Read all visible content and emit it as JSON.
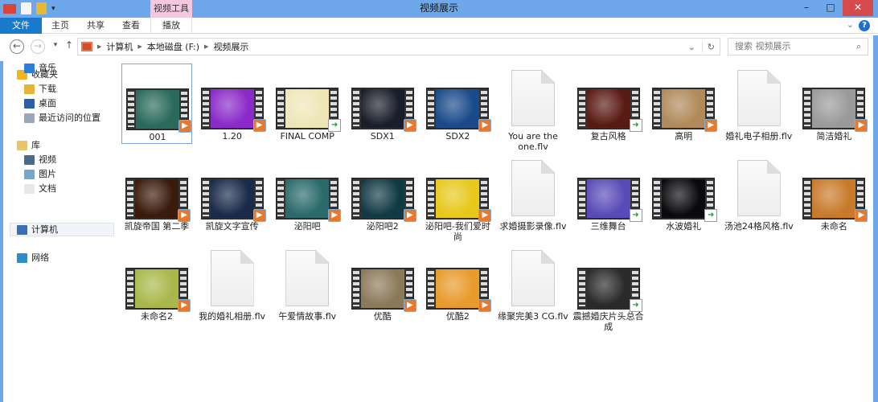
{
  "window": {
    "title": "视频展示",
    "context_tab": "视频工具",
    "minimize": "–",
    "maximize": "□",
    "close": "✕"
  },
  "ribbon": {
    "tabs": [
      "文件",
      "主页",
      "共享",
      "查看",
      "播放"
    ],
    "help": "?"
  },
  "nav": {
    "back": "←",
    "forward": "→",
    "recent": "▾",
    "up": "↑",
    "breadcrumb": [
      "计算机",
      "本地磁盘 (F:)",
      "视频展示"
    ],
    "refresh": "↻",
    "dropdown": "⌄",
    "search_placeholder": "搜索 视频展示",
    "search_icon": "⌕"
  },
  "sidebar": {
    "groups": [
      {
        "label": "收藏夹",
        "icon": "star-icon",
        "color": "#f2b51d",
        "children": [
          {
            "label": "下载",
            "icon": "downloads-icon",
            "color": "#e6b43a"
          },
          {
            "label": "桌面",
            "icon": "desktop-icon",
            "color": "#2a5fa8"
          },
          {
            "label": "最近访问的位置",
            "icon": "recent-places-icon",
            "color": "#9aa8b8"
          }
        ]
      },
      {
        "label": "库",
        "icon": "library-icon",
        "color": "#e9c56a",
        "children": [
          {
            "label": "视频",
            "icon": "videos-icon",
            "color": "#4a6a8a"
          },
          {
            "label": "图片",
            "icon": "pictures-icon",
            "color": "#7aa6c8"
          },
          {
            "label": "文档",
            "icon": "documents-icon",
            "color": "#e8e8e8"
          },
          {
            "label": "音乐",
            "icon": "music-icon",
            "color": "#2a7fd8"
          }
        ]
      },
      {
        "label": "计算机",
        "icon": "computer-icon",
        "color": "#3a6fb8",
        "children": []
      },
      {
        "label": "网络",
        "icon": "network-icon",
        "color": "#2a8fc8",
        "children": []
      }
    ]
  },
  "files": [
    {
      "name": "001",
      "type": "video",
      "badge": "play",
      "thumb": "#2a6a5a",
      "selected": true
    },
    {
      "name": "1.20",
      "type": "video",
      "badge": "play",
      "thumb": "#8a2ac8"
    },
    {
      "name": "FINAL COMP",
      "type": "video",
      "badge": "arrow",
      "thumb": "#efe6b8"
    },
    {
      "name": "SDX1",
      "type": "video",
      "badge": "play",
      "thumb": "#1a1e2a"
    },
    {
      "name": "SDX2",
      "type": "video",
      "badge": "play",
      "thumb": "#1a4a8a"
    },
    {
      "name": "You are the one.flv",
      "type": "file"
    },
    {
      "name": "复古风格",
      "type": "video",
      "badge": "arrow",
      "thumb": "#5a1a14"
    },
    {
      "name": "高明",
      "type": "video",
      "badge": "play",
      "thumb": "#b08a5a"
    },
    {
      "name": "婚礼电子相册.flv",
      "type": "file"
    },
    {
      "name": "简洁婚礼",
      "type": "video",
      "badge": "play",
      "thumb": "#9a9a9a"
    },
    {
      "name": "凯旋帝国 第二季",
      "type": "video",
      "badge": "play",
      "thumb": "#3a1a0a"
    },
    {
      "name": "凯旋文字宣传",
      "type": "video",
      "badge": "play",
      "thumb": "#1a2a4a"
    },
    {
      "name": "泌阳吧",
      "type": "video",
      "badge": "play",
      "thumb": "#2a6a6a"
    },
    {
      "name": "泌阳吧2",
      "type": "video",
      "badge": "play",
      "thumb": "#123a44"
    },
    {
      "name": "泌阳吧-我们爱时尚",
      "type": "video",
      "badge": "play",
      "thumb": "#e8c81a"
    },
    {
      "name": "求婚摄影录像.flv",
      "type": "file"
    },
    {
      "name": "三维舞台",
      "type": "video",
      "badge": "arrow",
      "thumb": "#5a4ab8"
    },
    {
      "name": "水波婚礼",
      "type": "video",
      "badge": "arrow",
      "thumb": "#0a0a0e"
    },
    {
      "name": "汤池24格风格.flv",
      "type": "file"
    },
    {
      "name": "未命名",
      "type": "video",
      "badge": "play",
      "thumb": "#c87a2a"
    },
    {
      "name": "未命名2",
      "type": "video",
      "badge": "play",
      "thumb": "#a8b84a"
    },
    {
      "name": "我的婚礼相册.flv",
      "type": "file"
    },
    {
      "name": "午爱情故事.flv",
      "type": "file"
    },
    {
      "name": "优酷",
      "type": "video",
      "badge": "play",
      "thumb": "#8a7a5a"
    },
    {
      "name": "优酷2",
      "type": "video",
      "badge": "play",
      "thumb": "#e89a2a"
    },
    {
      "name": "缘聚完美3 CG.flv",
      "type": "file"
    },
    {
      "name": "震撼婚庆片头总合成",
      "type": "video",
      "badge": "arrow",
      "thumb": "#2a2a2a"
    }
  ]
}
